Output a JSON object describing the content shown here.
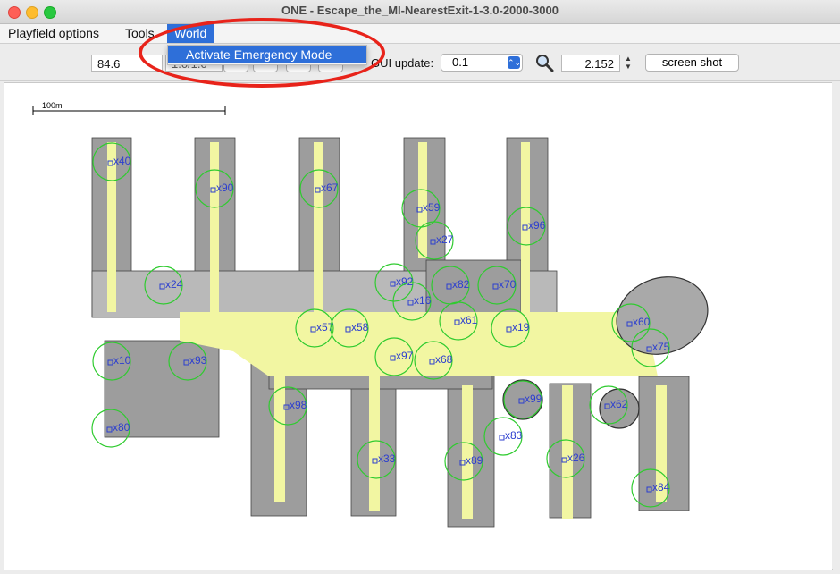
{
  "window": {
    "title": "ONE - Escape_the_MI-NearestExit-1-3.0-2000-3000"
  },
  "menu": {
    "items": [
      "Playfield options",
      "Tools",
      "World"
    ],
    "active": "World",
    "dropdown": [
      "Activate Emergency Mode"
    ]
  },
  "toolbar": {
    "sim_time": "84.6",
    "update_label": "GUI update:",
    "update_value": "0.1",
    "zoom_value": "2.152",
    "screenshot_label": "screen shot",
    "hidden_field": "1.0/1.0"
  },
  "map": {
    "scale_label": "100m",
    "colors": {
      "floor": "#f2f6a2",
      "wall": "#9a9a9a",
      "node": "#2c3ecf",
      "range": "#2fcb2f",
      "annotation": "#e8231a"
    },
    "nodes": [
      {
        "label": "x40"
      },
      {
        "label": "x90"
      },
      {
        "label": "x67"
      },
      {
        "label": "x59"
      },
      {
        "label": "x96"
      },
      {
        "label": "x27"
      },
      {
        "label": "x24"
      },
      {
        "label": "x92"
      },
      {
        "label": "x82"
      },
      {
        "label": "x70"
      },
      {
        "label": "x16"
      },
      {
        "label": "x61"
      },
      {
        "label": "x60"
      },
      {
        "label": "x57"
      },
      {
        "label": "x58"
      },
      {
        "label": "x19"
      },
      {
        "label": "x75"
      },
      {
        "label": "x10"
      },
      {
        "label": "x93"
      },
      {
        "label": "x97"
      },
      {
        "label": "x68"
      },
      {
        "label": "x99"
      },
      {
        "label": "x98"
      },
      {
        "label": "x62"
      },
      {
        "label": "x80"
      },
      {
        "label": "x83"
      },
      {
        "label": "x33"
      },
      {
        "label": "x89"
      },
      {
        "label": "x26"
      },
      {
        "label": "x84"
      }
    ]
  }
}
